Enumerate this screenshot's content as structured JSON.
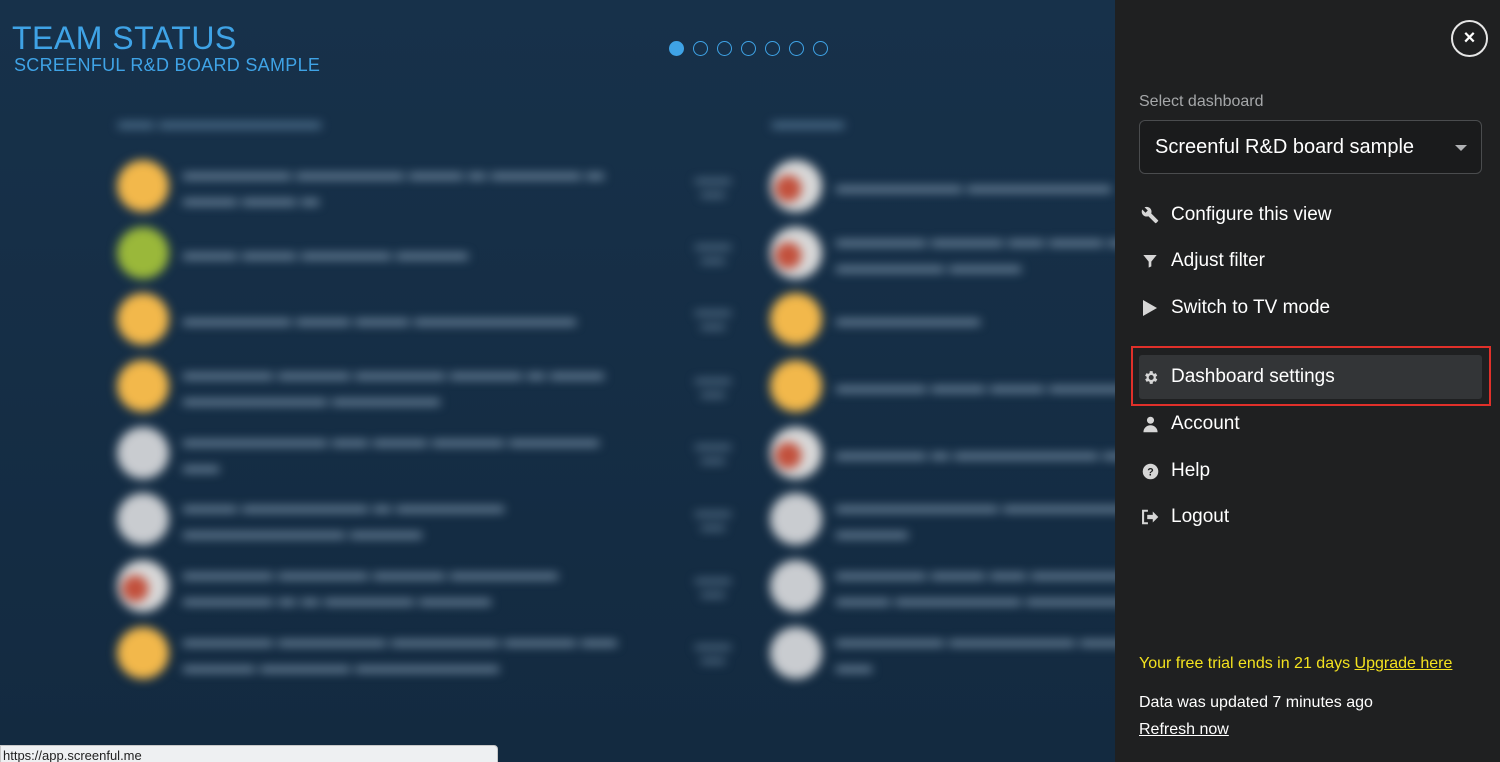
{
  "dashboard": {
    "title": "TEAM STATUS",
    "subtitle": "SCREENFUL R&D BOARD SAMPLE",
    "carousel": {
      "total": 7,
      "active_index": 0
    },
    "accent_color": "#3fa3e6"
  },
  "url_tooltip": "https://app.screenful.me",
  "panel": {
    "close_icon": "×",
    "select_label": "Select dashboard",
    "select_value": "Screenful R&D board sample",
    "menu": [
      {
        "label": "Configure this view",
        "icon": "wrench-icon"
      },
      {
        "label": "Adjust filter",
        "icon": "filter-icon"
      },
      {
        "label": "Switch to TV mode",
        "icon": "play-icon"
      },
      {
        "label": "Dashboard settings",
        "icon": "gear-icon",
        "selected": true
      },
      {
        "label": "Account",
        "icon": "user-icon"
      },
      {
        "label": "Help",
        "icon": "help-icon"
      },
      {
        "label": "Logout",
        "icon": "logout-icon"
      }
    ],
    "trial_text": "Your free trial ends in 21 days",
    "upgrade_link": "Upgrade here",
    "updated_text": "Data was updated 7 minutes ago",
    "refresh_link": "Refresh now",
    "highlight_color": "#e0302a",
    "trial_color": "#f3e21f"
  }
}
